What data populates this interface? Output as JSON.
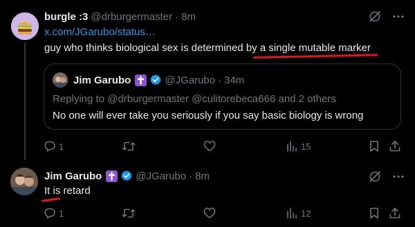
{
  "post1": {
    "display_name": "burgle :3",
    "handle": "@drburgermaster",
    "separator": "·",
    "time": "8m",
    "link": "x.com/JGarubo/status…",
    "text": "guy who thinks biological sex is determined by a single mutable marker",
    "quote": {
      "display_name": "Jim Garubo",
      "handle": "@JGarubo",
      "separator": "·",
      "time": "34m",
      "replying_to": "Replying to @drburgermaster @culitorebeca666 and 2 others",
      "text": "No one will ever take you seriously if you say basic biology is wrong"
    },
    "actions": {
      "replies": "1",
      "views": "15"
    }
  },
  "post2": {
    "display_name": "Jim Garubo",
    "handle": "@JGarubo",
    "separator": "·",
    "time": "8m",
    "text": "It is retard",
    "actions": {
      "replies": "1",
      "views": "12"
    }
  },
  "colors": {
    "background": "#000000",
    "text": "#e7e9ea",
    "muted": "#71767b",
    "link": "#1d9bf0",
    "annotation": "#e8131b",
    "verified": "#1d9bf0",
    "cross_badge": "#8c55cf"
  },
  "icons": [
    "burger-avatar-icon",
    "grok-icon",
    "more-icon",
    "cross-badge-icon",
    "verified-badge-icon",
    "reply-icon",
    "repost-icon",
    "like-icon",
    "views-icon",
    "bookmark-icon",
    "share-icon"
  ]
}
